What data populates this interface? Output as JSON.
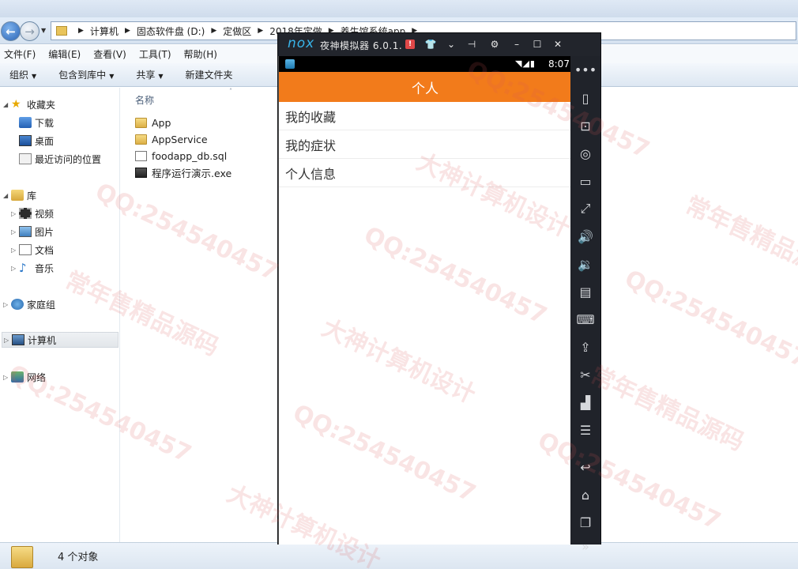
{
  "explorer": {
    "address": {
      "crumbs": [
        "计算机",
        "固态软件盘 (D:)",
        "定做区",
        "2018年定做",
        "养生馆系统app"
      ]
    },
    "menu": [
      "文件(F)",
      "编辑(E)",
      "查看(V)",
      "工具(T)",
      "帮助(H)"
    ],
    "toolbar": {
      "organize": "组织",
      "include_library": "包含到库中",
      "share": "共享",
      "new_folder": "新建文件夹"
    },
    "sidebar": {
      "favorites": "收藏夹",
      "downloads": "下载",
      "desktop": "桌面",
      "recent": "最近访问的位置",
      "libraries": "库",
      "videos": "视频",
      "pictures": "图片",
      "documents": "文档",
      "music": "音乐",
      "homegroup": "家庭组",
      "computer": "计算机",
      "network": "网络"
    },
    "column_header": "名称",
    "files": [
      {
        "name": "App",
        "type": "folder"
      },
      {
        "name": "AppService",
        "type": "folder"
      },
      {
        "name": "foodapp_db.sql",
        "type": "sql"
      },
      {
        "name": "程序运行演示.exe",
        "type": "exe"
      }
    ],
    "status": "4 个对象"
  },
  "emulator": {
    "logo": "nox",
    "title": "夜神模拟器 6.0.1.",
    "status_time": "8:07",
    "app": {
      "header_title": "个人",
      "header_color": "#f27b1b",
      "menu_items": [
        "我的收藏",
        "我的症状",
        "个人信息"
      ]
    },
    "toolbar_icons": [
      "phone-rotate-icon",
      "robot-icon",
      "location-icon",
      "screen-icon",
      "fullscreen-icon",
      "volume-up-icon",
      "volume-down-icon",
      "toolbox-icon",
      "keymap-icon",
      "apk-install-icon",
      "scissors-icon",
      "multi-instance-icon",
      "menu-icon",
      "back-icon",
      "home-icon",
      "recents-icon",
      "expand-icon"
    ]
  },
  "watermarks": [
    "QQ:254540457",
    "常年售精品源码",
    "大神计算机设计"
  ]
}
